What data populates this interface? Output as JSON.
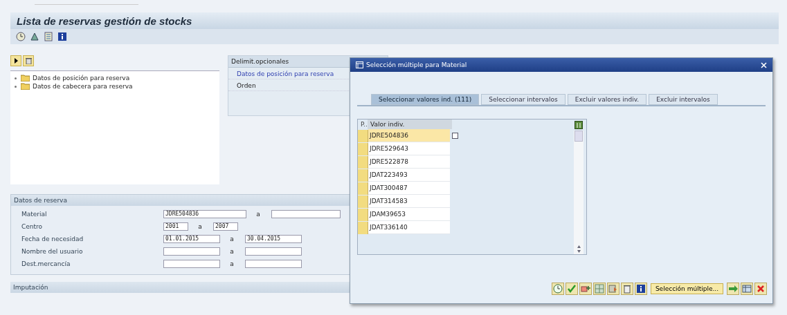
{
  "window": {
    "title": "Lista de reservas gestión de stocks"
  },
  "tree": {
    "items": [
      {
        "label": "Datos de posición para reserva"
      },
      {
        "label": "Datos de cabecera para reserva"
      }
    ]
  },
  "optional_panel": {
    "title": "Delimit.opcionales",
    "items": [
      {
        "label": "Datos de posición para reserva",
        "kind": "link"
      },
      {
        "label": "Orden",
        "kind": "text"
      }
    ]
  },
  "reservation_section": {
    "title": "Datos de reserva",
    "fields": [
      {
        "label": "Material",
        "from": "JDRE504836",
        "to_separator": "a"
      },
      {
        "label": "Centro",
        "from": "2001",
        "to_separator": "a",
        "to": "2007"
      },
      {
        "label": "Fecha de necesidad",
        "from": "01.01.2015",
        "to_separator": "a",
        "to": "30.04.2015"
      },
      {
        "label": "Nombre del usuario",
        "to_separator": "a"
      },
      {
        "label": "Dest.mercancía",
        "to_separator": "a"
      }
    ]
  },
  "next_section": {
    "title": "Imputación"
  },
  "dialog": {
    "title": "Selección múltiple para Material",
    "tabs": [
      {
        "label": "Seleccionar valores ind. (111)",
        "selected": true
      },
      {
        "label": "Seleccionar intervalos",
        "selected": false
      },
      {
        "label": "Excluir valores indiv.",
        "selected": false
      },
      {
        "label": "Excluir intervalos",
        "selected": false
      }
    ],
    "table": {
      "columns": [
        "P..",
        "Valor indiv."
      ],
      "rows": [
        {
          "value": "JDRE504836",
          "selected": true
        },
        {
          "value": "JDRE529643",
          "selected": false
        },
        {
          "value": "JDRE522878",
          "selected": false
        },
        {
          "value": "JDAT223493",
          "selected": false
        },
        {
          "value": "JDAT300487",
          "selected": false
        },
        {
          "value": "JDAT314583",
          "selected": false
        },
        {
          "value": "JDAM39653",
          "selected": false
        },
        {
          "value": "JDAT336140",
          "selected": false
        }
      ]
    },
    "multi_button": "Selección múltiple..."
  }
}
